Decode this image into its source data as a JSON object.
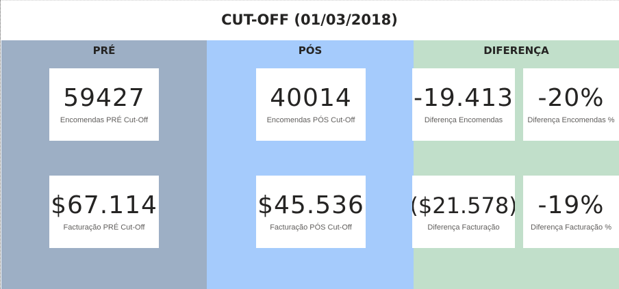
{
  "title": "CUT-OFF (01/03/2018)",
  "colors": {
    "pre": "#9dafc5",
    "pos": "#a5cbfc",
    "diferenca": "#c1dfca"
  },
  "sections": {
    "pre": {
      "header": "PRÉ",
      "orders": {
        "value": "59427",
        "label": "Encomendas PRÉ Cut-Off"
      },
      "billing": {
        "value": "$67.114",
        "label": "Facturação PRÉ Cut-Off"
      }
    },
    "pos": {
      "header": "PÓS",
      "orders": {
        "value": "40014",
        "label": "Encomendas PÓS Cut-Off"
      },
      "billing": {
        "value": "$45.536",
        "label": "Facturação PÓS Cut-Off"
      }
    },
    "diferenca": {
      "header": "DIFERENÇA",
      "orders": {
        "value": "-19.413",
        "label": "Diferença Encomendas"
      },
      "orders_pct": {
        "value": "-20%",
        "label": "Diferença Encomendas %"
      },
      "billing": {
        "value": "($21.578)",
        "label": "Diferença Facturação"
      },
      "billing_pct": {
        "value": "-19%",
        "label": "Diferença Facturação %"
      }
    }
  }
}
